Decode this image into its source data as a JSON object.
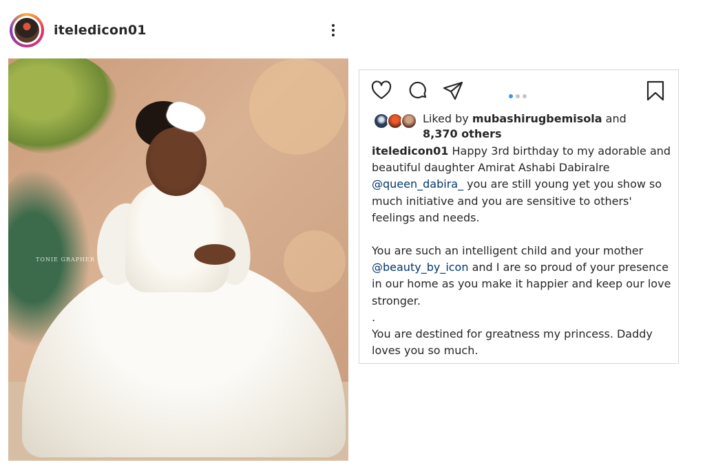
{
  "post": {
    "username": "iteledicon01",
    "photo_watermark": "TONIE GRAPHER"
  },
  "actions": {
    "icons": [
      "heart-icon",
      "comment-icon",
      "share-icon",
      "bookmark-icon"
    ],
    "carousel": {
      "current": 1,
      "total": 3
    }
  },
  "likes": {
    "prefix": "Liked by",
    "user": "mubashirugbemisola",
    "connector": "and",
    "others": "8,370 others"
  },
  "caption": {
    "author": "iteledicon01",
    "line1": "Happy 3rd birthday to my adorable and beautiful daughter Amirat Ashabi Dabiralre",
    "mention1": "@queen_dabira_",
    "line1b": "you are still young yet you show so much initiative and you are sensitive to others' feelings and needs.",
    "line2a": "You are such an intelligent child and your mother",
    "mention2": "@beauty_by_icon",
    "line2b": "and I are so proud of your presence in our home as you make it happier and keep our love stronger.",
    "dot": ".",
    "line3": "You are destined for greatness my princess. Daddy loves you so much."
  },
  "colors": {
    "mention": "#00376b",
    "dot_active": "#3897f0",
    "dot_inactive": "#c4c4c4",
    "text": "#262626"
  }
}
